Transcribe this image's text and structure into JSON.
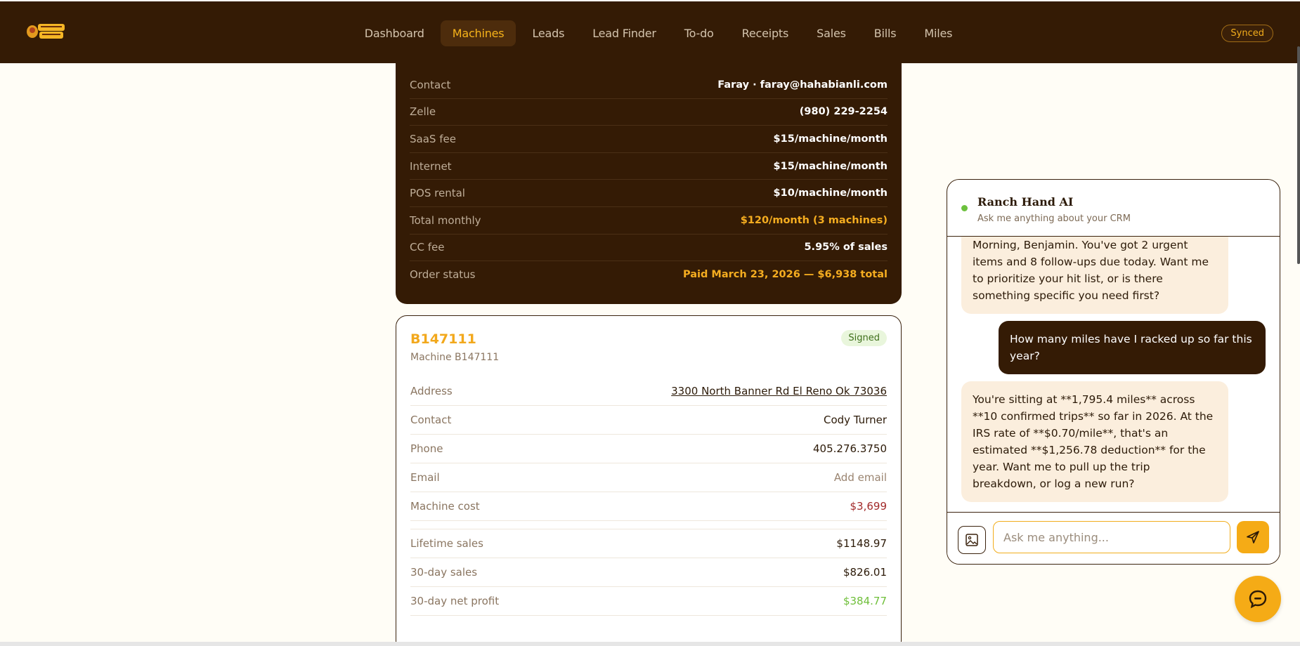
{
  "nav": {
    "items": [
      "Dashboard",
      "Machines",
      "Leads",
      "Lead Finder",
      "To-do",
      "Receipts",
      "Sales",
      "Bills",
      "Miles"
    ],
    "active": "Machines",
    "sync_status": "Synced"
  },
  "order": {
    "rows": [
      {
        "label": "Contact",
        "value": "Faray · faray@hahabianli.com"
      },
      {
        "label": "Zelle",
        "value": "(980) 229-2254"
      },
      {
        "label": "SaaS fee",
        "value": "$15/machine/month"
      },
      {
        "label": "Internet",
        "value": "$15/machine/month"
      },
      {
        "label": "POS rental",
        "value": "$10/machine/month"
      },
      {
        "label": "Total monthly",
        "value": "$120/month (3 machines)"
      },
      {
        "label": "CC fee",
        "value": "5.95% of sales"
      },
      {
        "label": "Order status",
        "value": "Paid March 23, 2026 — $6,938 total"
      }
    ]
  },
  "machine": {
    "id": "B147111",
    "subtitle": "Machine B147111",
    "status": "Signed",
    "address_label": "Address",
    "address": "3300 North Banner Rd El Reno Ok 73036",
    "contact_label": "Contact",
    "contact": "Cody Turner",
    "phone_label": "Phone",
    "phone": "405.276.3750",
    "email_label": "Email",
    "email_action": "Add email",
    "cost_label": "Machine cost",
    "cost": "$3,699",
    "lifetime_label": "Lifetime sales",
    "lifetime": "$1148.97",
    "sales30_label": "30-day sales",
    "sales30": "$826.01",
    "profit30_label": "30-day net profit",
    "profit30": "$384.77"
  },
  "chat": {
    "title": "Ranch Hand AI",
    "subtitle": "Ask me anything about your CRM",
    "messages": [
      {
        "from": "ai",
        "text": "Morning, Benjamin. You've got 2 urgent items and 8 follow-ups due today. Want me to prioritize your hit list, or is there something specific you need first?"
      },
      {
        "from": "user",
        "text": "How many miles have I racked up so far this year?"
      },
      {
        "from": "ai",
        "text": "You're sitting at **1,795.4 miles** across **10 confirmed trips** so far in 2026. At the IRS rate of **$0.70/mile**, that's an estimated **$1,256.78 deduction** for the year. Want me to pull up the trip breakdown, or log a new run?"
      }
    ],
    "input_placeholder": "Ask me anything..."
  },
  "colors": {
    "brand_dark": "#341b05",
    "accent_gold": "#f5ab16",
    "cream": "#fffdf6"
  }
}
